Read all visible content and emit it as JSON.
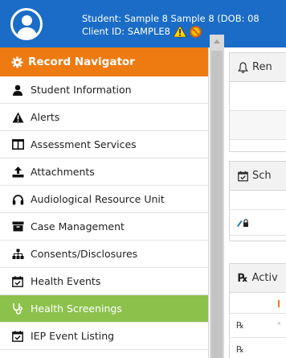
{
  "header": {
    "student_line": "Student: Sample 8 Sample 8 (DOB: 08",
    "client_line": "Client ID: SAMPLE8",
    "bg_color": "#1a6cc7"
  },
  "sidebar": {
    "title": "Record Navigator",
    "title_color": "#ee7a12",
    "active_color": "#8cc14c",
    "items": [
      {
        "label": "Student Information",
        "icon": "user-icon"
      },
      {
        "label": "Alerts",
        "icon": "alert-icon"
      },
      {
        "label": "Assessment Services",
        "icon": "columns-icon"
      },
      {
        "label": "Attachments",
        "icon": "upload-icon"
      },
      {
        "label": "Audiological Resource Unit",
        "icon": "headphones-icon"
      },
      {
        "label": "Case Management",
        "icon": "archive-icon"
      },
      {
        "label": "Consents/Disclosures",
        "icon": "sitemap-icon"
      },
      {
        "label": "Health Events",
        "icon": "calendar-check-icon"
      },
      {
        "label": "Health Screenings",
        "icon": "stethoscope-icon",
        "active": true
      },
      {
        "label": "IEP Event Listing",
        "icon": "calendar-check-icon"
      }
    ]
  },
  "panels": {
    "reminders_title": "Ren",
    "schedule_title": "Sch",
    "active_title": "Activ",
    "rx_symbol": "℞"
  }
}
